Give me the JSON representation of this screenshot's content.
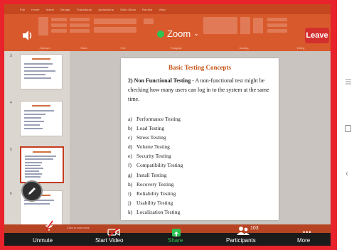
{
  "ribbon": {
    "tabs": [
      "File",
      "Home",
      "Insert",
      "Design",
      "Transitions",
      "Animations",
      "Slide Show",
      "Review",
      "View"
    ],
    "group_labels": [
      "Clipboard",
      "Slides",
      "Font",
      "Paragraph",
      "Drawing",
      "Editing"
    ]
  },
  "zoom": {
    "app_name": "Zoom",
    "leave_label": "Leave",
    "toolbar": {
      "unmute_label": "Unmute",
      "video_label": "Start Video",
      "share_label": "Share",
      "participants_label": "Participants",
      "participants_count": "103",
      "more_label": "More"
    }
  },
  "slide": {
    "title": "Basic Testing Concepts",
    "heading_num": "2)",
    "heading_bold": "Non Functional Testing",
    "heading_text": " - A non-functional test might be checking how many users can log in to the system at the same time.",
    "items": [
      {
        "marker": "a)",
        "text": "Performance Testing"
      },
      {
        "marker": "b)",
        "text": "Load Testing"
      },
      {
        "marker": "c)",
        "text": "Stress Testing"
      },
      {
        "marker": "d)",
        "text": "Volume Testing"
      },
      {
        "marker": "e)",
        "text": "Security Testing"
      },
      {
        "marker": "f)",
        "text": "Compatibility Testing"
      },
      {
        "marker": "g)",
        "text": "Install Testing"
      },
      {
        "marker": "h)",
        "text": "Recovery Testing"
      },
      {
        "marker": "i)",
        "text": "Reliability Testing"
      },
      {
        "marker": "j)",
        "text": "Usability Testing"
      },
      {
        "marker": "k)",
        "text": "Localization Testing"
      }
    ]
  },
  "thumbnails": {
    "numbers": [
      "3",
      "4",
      "5",
      "6"
    ]
  },
  "status": {
    "notes_hint": "Click to add notes"
  },
  "colors": {
    "leave": "#d42f2f",
    "zoom_green": "#2dc453",
    "frame_red": "#e8232b",
    "ribbon": "#c5471f"
  }
}
